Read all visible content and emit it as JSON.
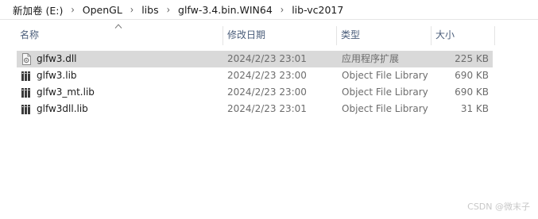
{
  "breadcrumb": {
    "items": [
      "新加卷 (E:)",
      "OpenGL",
      "libs",
      "glfw-3.4.bin.WIN64",
      "lib-vc2017"
    ],
    "separator": "›"
  },
  "columns": {
    "name": "名称",
    "date": "修改日期",
    "type": "类型",
    "size": "大小"
  },
  "files": [
    {
      "name": "glfw3.dll",
      "date": "2024/2/23 23:01",
      "type": "应用程序扩展",
      "size": "225 KB",
      "icon": "dll-file-icon",
      "selected": true
    },
    {
      "name": "glfw3.lib",
      "date": "2024/2/23 23:00",
      "type": "Object File Library",
      "size": "690 KB",
      "icon": "lib-file-icon",
      "selected": false
    },
    {
      "name": "glfw3_mt.lib",
      "date": "2024/2/23 23:00",
      "type": "Object File Library",
      "size": "690 KB",
      "icon": "lib-file-icon",
      "selected": false
    },
    {
      "name": "glfw3dll.lib",
      "date": "2024/2/23 23:01",
      "type": "Object File Library",
      "size": "31 KB",
      "icon": "lib-file-icon",
      "selected": false
    }
  ],
  "watermark": "CSDN @微末子",
  "colors": {
    "selected_row": "#d9d9d9",
    "header_text": "#4a5d7a",
    "secondary_text": "#6d6d6d"
  }
}
